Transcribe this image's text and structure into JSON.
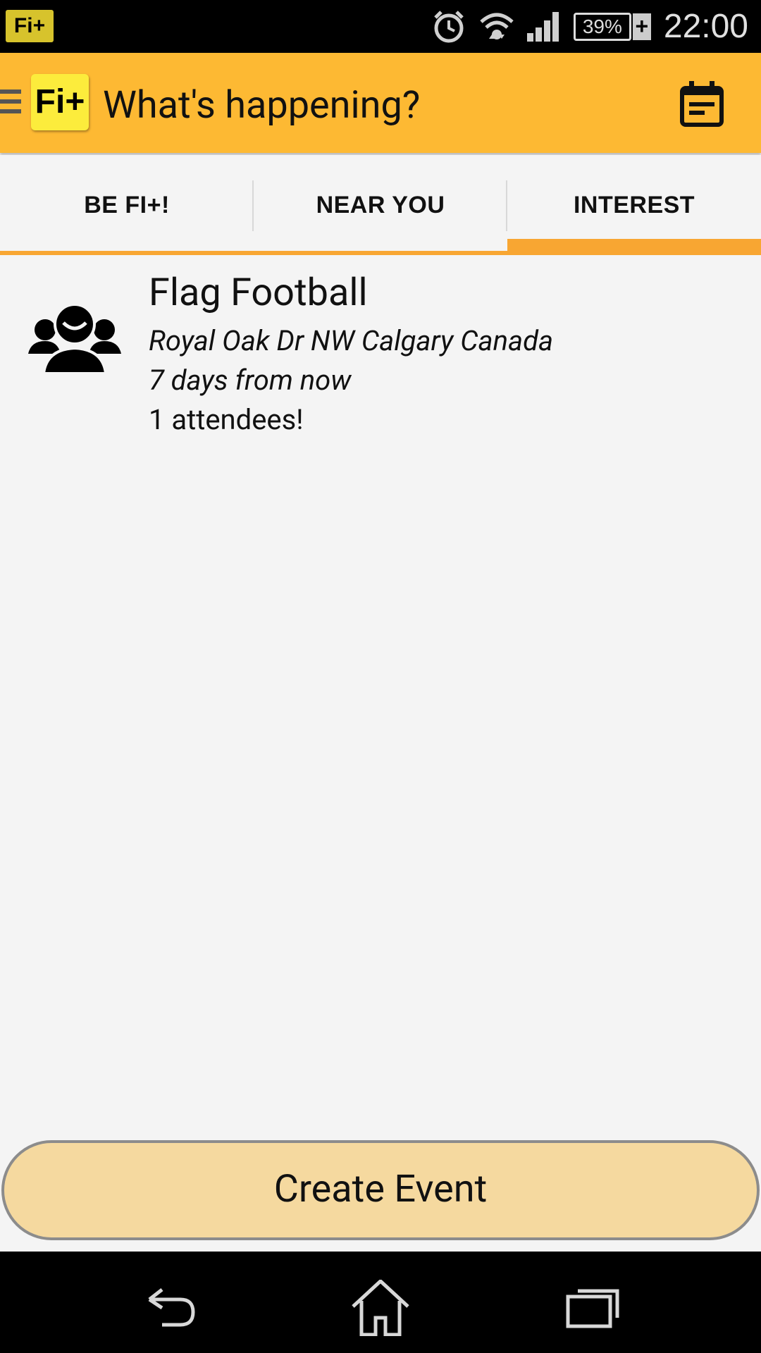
{
  "status_bar": {
    "app_icon_label": "Fi+",
    "icons": [
      "alarm-icon",
      "wifi-icon",
      "signal-icon"
    ],
    "battery_percent": "39%",
    "battery_charging_label": "+",
    "time": "22:00"
  },
  "app_bar": {
    "logo_text": "Fi+",
    "title": "What's happening?",
    "background_color": "#fdb933",
    "logo_color": "#fcec3c"
  },
  "tabs": [
    {
      "label": "BE FI+!",
      "selected": false
    },
    {
      "label": "NEAR YOU",
      "selected": false
    },
    {
      "label": "INTEREST",
      "selected": true
    }
  ],
  "accent_color": "#f8a632",
  "events": [
    {
      "title": "Flag Football",
      "location": "Royal Oak Dr NW Calgary Canada",
      "when": "7 days from now",
      "attendees": "1 attendees!",
      "icon": "group-icon"
    }
  ],
  "create_button": {
    "label": "Create Event",
    "color": "#f5d99f"
  },
  "nav_bar": {
    "buttons": [
      "back-icon",
      "home-icon",
      "recent-apps-icon"
    ]
  }
}
